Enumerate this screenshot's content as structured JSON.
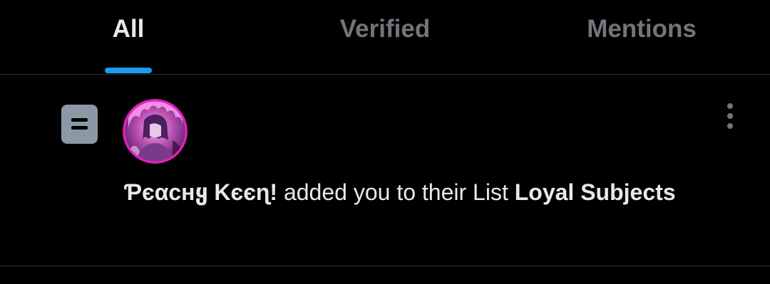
{
  "tabs": [
    {
      "label": "All",
      "active": true
    },
    {
      "label": "Verified",
      "active": false
    },
    {
      "label": "Mentions",
      "active": false
    }
  ],
  "notification": {
    "type_icon": "list-icon",
    "avatar_icon": "user-avatar",
    "menu_icon": "more-vertical-icon",
    "user_name": "Ƥєαcнყ Kєєɳ!",
    "action_text": " added you to their List ",
    "list_name": "Loyal Subjects"
  },
  "colors": {
    "background": "#000000",
    "text_primary": "#e7e9ea",
    "text_secondary": "#71767b",
    "accent": "#1d9bf0",
    "divider": "#2f3336",
    "list_icon_bg": "#8b98a5",
    "avatar_ring": "#e020c0"
  }
}
